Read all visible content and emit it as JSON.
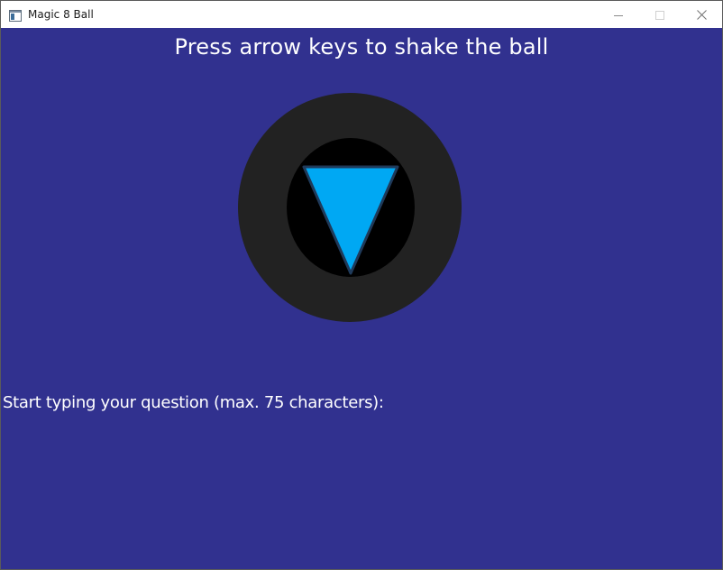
{
  "window": {
    "title": "Magic 8 Ball",
    "icon": "app-window-icon",
    "controls": {
      "minimize": "minimize-icon",
      "maximize": "maximize-icon",
      "close": "close-icon"
    }
  },
  "game": {
    "heading": "Press arrow keys to shake the ball",
    "prompt": "Start typing your question (max. 75 characters):",
    "colors": {
      "background": "#31318f",
      "ball_outer": "#222222",
      "ball_window": "#000000",
      "die_fill": "#00a8f3",
      "die_stroke": "#1f3a5a"
    }
  }
}
